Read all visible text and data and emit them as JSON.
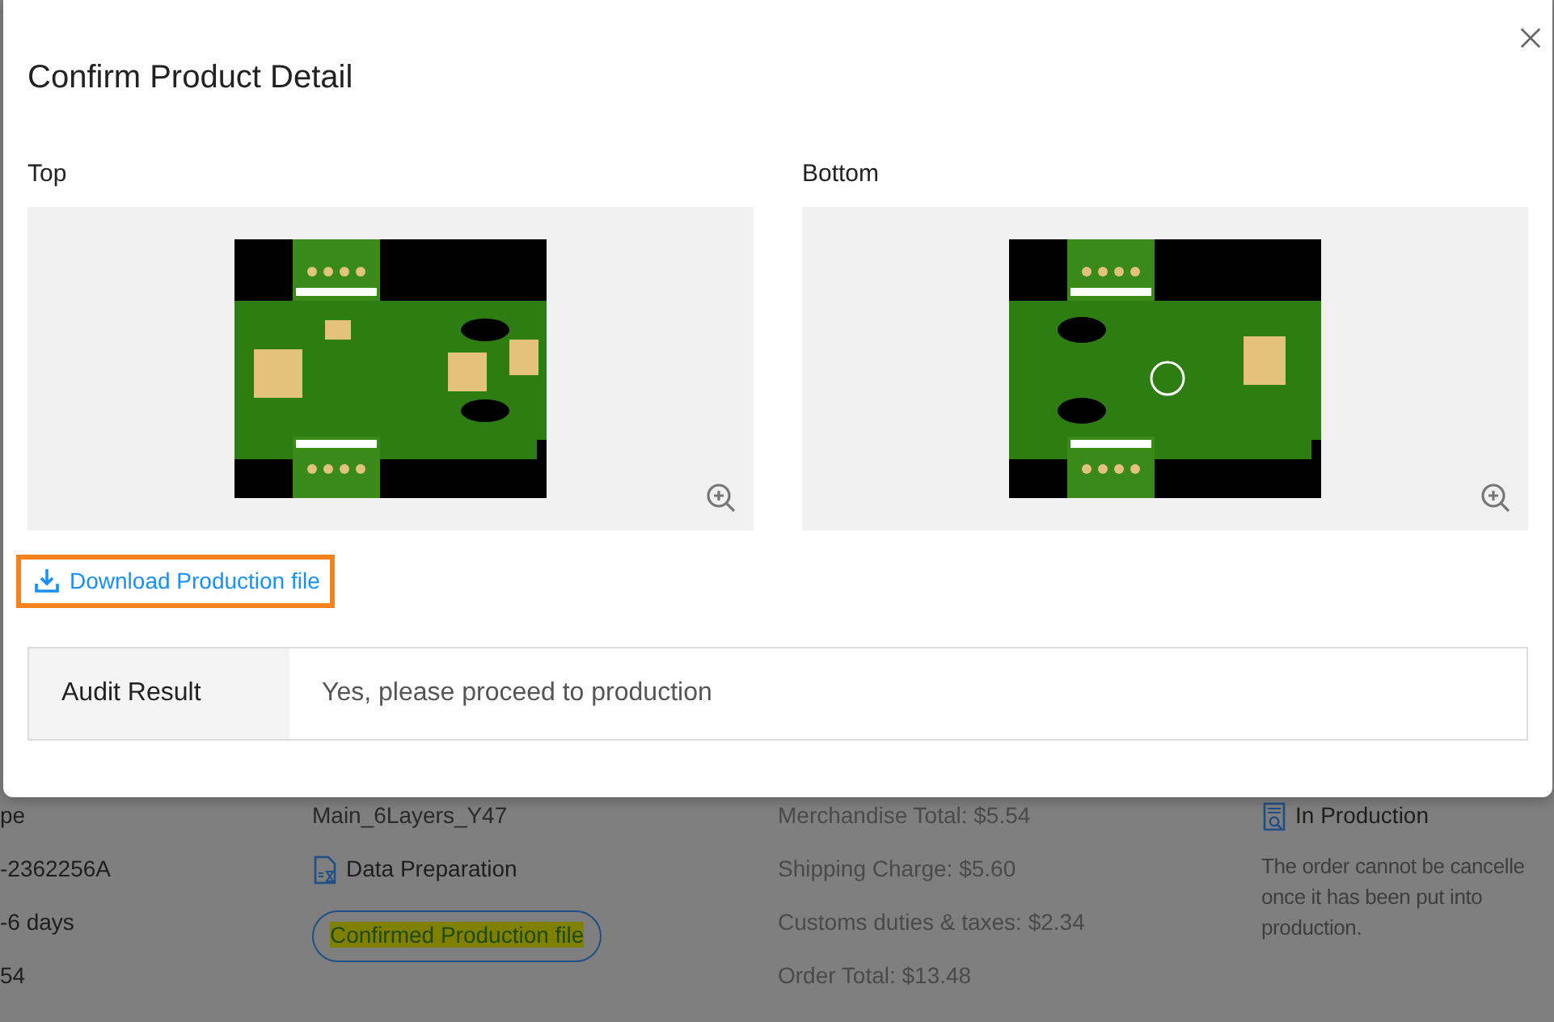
{
  "modal": {
    "title": "Confirm Product Detail",
    "views": [
      {
        "label": "Top",
        "kind": "top"
      },
      {
        "label": "Bottom",
        "kind": "bottom"
      }
    ],
    "download_link": {
      "label": "Download Production file",
      "highlighted": true
    },
    "audit": {
      "label": "Audit Result",
      "value": "Yes, please proceed to production"
    }
  },
  "background": {
    "columns": [
      {
        "items": [
          {
            "kind": "text",
            "text": "pe"
          },
          {
            "kind": "text",
            "text": "-2362256A"
          },
          {
            "kind": "text",
            "text": "-6 days"
          },
          {
            "kind": "text",
            "text": "54"
          }
        ]
      },
      {
        "items": [
          {
            "kind": "text",
            "text": "Main_6Layers_Y47"
          },
          {
            "kind": "status",
            "text": "Data Preparation"
          },
          {
            "kind": "badge",
            "text": "Confirmed Production file"
          }
        ]
      },
      {
        "items": [
          {
            "kind": "amount",
            "text": "Merchandise Total: $5.54"
          },
          {
            "kind": "amount",
            "text": "Shipping Charge: $5.60"
          },
          {
            "kind": "amount",
            "text": "Customs duties & taxes: $2.34"
          },
          {
            "kind": "amount",
            "text": "Order Total: $13.48"
          }
        ]
      },
      {
        "items": [
          {
            "kind": "status",
            "text": "In Production"
          },
          {
            "kind": "note",
            "lines": [
              "The order cannot be cancelle",
              "once it has been put into",
              "production."
            ]
          }
        ]
      }
    ]
  }
}
